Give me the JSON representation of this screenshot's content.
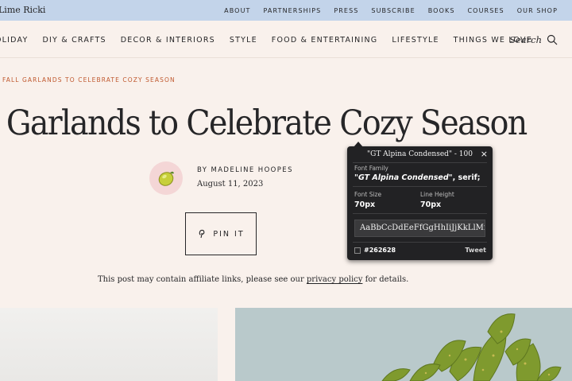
{
  "site": {
    "brand": "Lime Ricki"
  },
  "top_nav": [
    "ABOUT",
    "PARTNERSHIPS",
    "PRESS",
    "SUBSCRIBE",
    "BOOKS",
    "COURSES",
    "OUR SHOP"
  ],
  "main_nav": [
    "OLIDAY",
    "DIY & CRAFTS",
    "DECOR & INTERIORS",
    "STYLE",
    "FOOD & ENTERTAINING",
    "LIFESTYLE",
    "THINGS WE LOVE"
  ],
  "search": {
    "label": "Search",
    "icon": "search-icon"
  },
  "article": {
    "breadcrumb": "FALL GARLANDS TO CELEBRATE COZY SEASON",
    "title": "l Garlands to Celebrate Cozy Season",
    "author": "BY MADELINE HOOPES",
    "date": "August 11, 2023",
    "pin_label": "PIN IT",
    "disclaimer_pre": "This post may contain affiliate links, please see our ",
    "disclaimer_link": "privacy policy",
    "disclaimer_post": " for details."
  },
  "inspector": {
    "title": "\"GT Alpina Condensed\" - 100",
    "close": "×",
    "family_label": "Font Family",
    "family_value": "\"GT Alpina Condensed\"",
    "family_fallback": ", serif;",
    "size_label": "Font Size",
    "size_value": "70px",
    "line_height_label": "Line Height",
    "line_height_value": "70px",
    "sample": "AaBbCcDdEeFfGgHhIiJjKkLlMmNnOoPp",
    "color": "#262628",
    "tweet": "Tweet"
  },
  "colors": {
    "background": "#f9f1ec",
    "topbar": "#c3d4ea",
    "text": "#262628",
    "accent": "#c0592f",
    "avatar_bg": "#f4d6d6",
    "inspector_bg": "#222224"
  }
}
